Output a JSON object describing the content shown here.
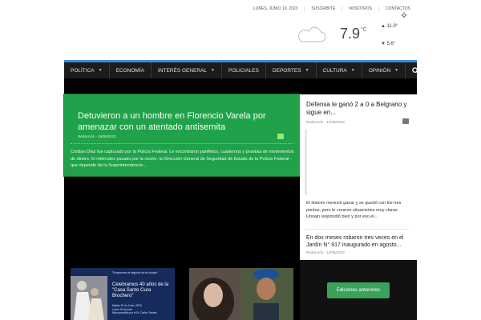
{
  "topbar": {
    "date": "LUNES, JUNIO 19, 2023",
    "links": [
      "SUSCRIBITE",
      "NOSOTROS",
      "CONTACTOS"
    ]
  },
  "weather": {
    "temp": "7.9",
    "unit": "°C",
    "max": "11.9°",
    "min": "5.6°",
    "icon": "cloud-night-icon"
  },
  "nav": {
    "items": [
      {
        "label": "POLÍTICA",
        "dropdown": true
      },
      {
        "label": "ECONOMÍA",
        "dropdown": false
      },
      {
        "label": "INTERÉS GENERAL",
        "dropdown": true
      },
      {
        "label": "POLICIALES",
        "dropdown": false
      },
      {
        "label": "DEPORTES",
        "dropdown": true
      },
      {
        "label": "CULTURA",
        "dropdown": true
      },
      {
        "label": "OPINIÓN",
        "dropdown": true
      }
    ],
    "accent": "#3b8bd6"
  },
  "feature": {
    "title": "Detuvieron a un hombre en Florencio Varela por amenazar con un atentado antisemita",
    "author": "Redacción",
    "date": "16/06/2023",
    "comments": "0",
    "excerpt": "Cristian Díaz fue capturado por la Policía Federal. Le encontraron panfletos, cuadernos y pruebas de movimientos de dinero. El miércoles pasado por la noche, la Dirección General de Seguridad de Estado de la Policía Federal -que depende de la Superintendencia...",
    "color": "#1fa24a"
  },
  "sidebar": {
    "post1": {
      "title": "Defensa le ganó 2 a 0 a Belgrano y sigue en...",
      "author": "Redacción",
      "date": "14/06/2023",
      "excerpt": "El Halcón mereció ganar y se quedó con los tres puntos, pero le crearon situaciones muy claras. Unsain respondió bien y por eso el..."
    },
    "post2": {
      "title": "En dos meses robaron tres veces en el Jardín N° 917 inaugurado en agosto...",
      "author": "Redacción",
      "date": "12/06/2023"
    }
  },
  "thumb1": {
    "top": "\"Empecemos el segundo de los cumple\"",
    "heading": "Celebramos 40 años de la \"Casa Santo Cura Brochero\"",
    "line1": "Martes 20 de Junio | 2023",
    "line2": "Lunes 19 de junio",
    "line3": "Misa presidida por el Sr. Carlos Tissera"
  },
  "lower": {
    "archive_label": "Ediciones anteriores"
  }
}
